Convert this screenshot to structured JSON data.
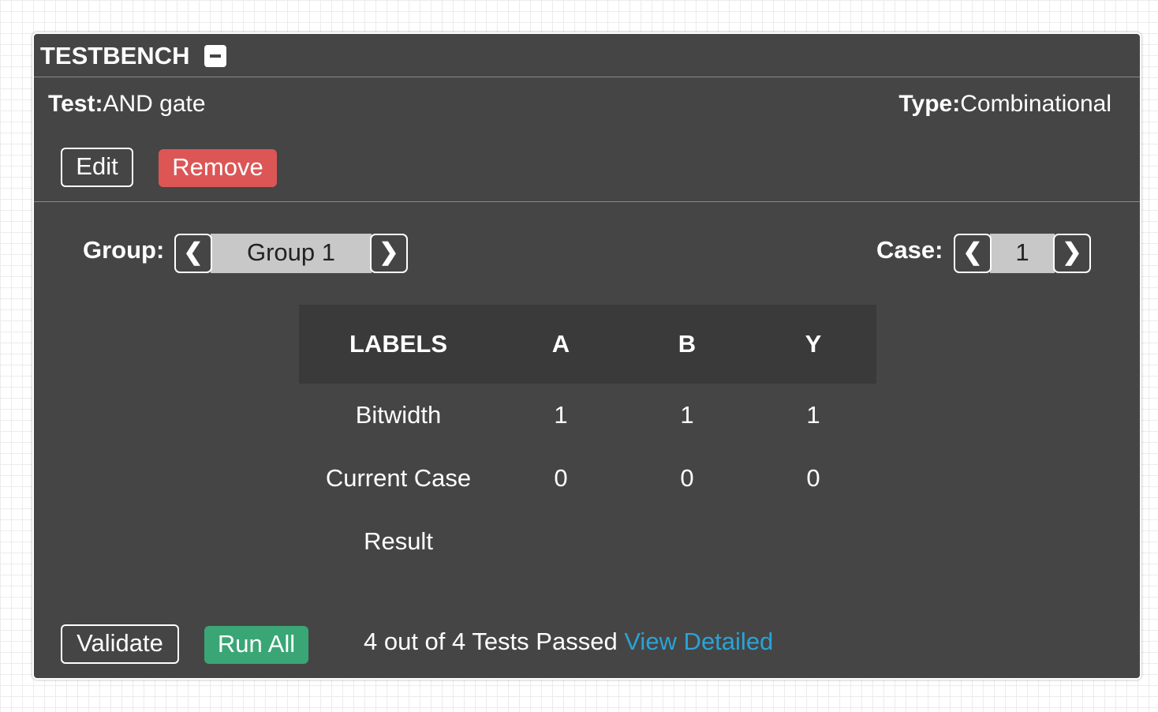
{
  "panel": {
    "title": "TESTBENCH",
    "test_label": "Test:",
    "test_value": "AND gate",
    "type_label": "Type:",
    "type_value": "Combinational"
  },
  "actions": {
    "edit_label": "Edit",
    "remove_label": "Remove"
  },
  "group_picker": {
    "label": "Group:",
    "value": "Group 1",
    "prev_icon": "chevron-left-icon",
    "next_icon": "chevron-right-icon"
  },
  "case_picker": {
    "label": "Case:",
    "value": "1",
    "prev_icon": "chevron-left-icon",
    "next_icon": "chevron-right-icon"
  },
  "table": {
    "headers": [
      "LABELS",
      "A",
      "B",
      "Y"
    ],
    "rows": [
      [
        "Bitwidth",
        "1",
        "1",
        "1"
      ],
      [
        "Current Case",
        "0",
        "0",
        "0"
      ],
      [
        "Result",
        "",
        "",
        ""
      ]
    ]
  },
  "footer": {
    "validate_label": "Validate",
    "run_all_label": "Run All",
    "status_text": "4 out of 4 Tests Passed",
    "view_detailed_label": "View Detailed"
  },
  "colors": {
    "panel_bg": "#454545",
    "remove_red": "#dc5656",
    "run_all_green": "#3aa676",
    "link_blue": "#2aa3d6"
  }
}
